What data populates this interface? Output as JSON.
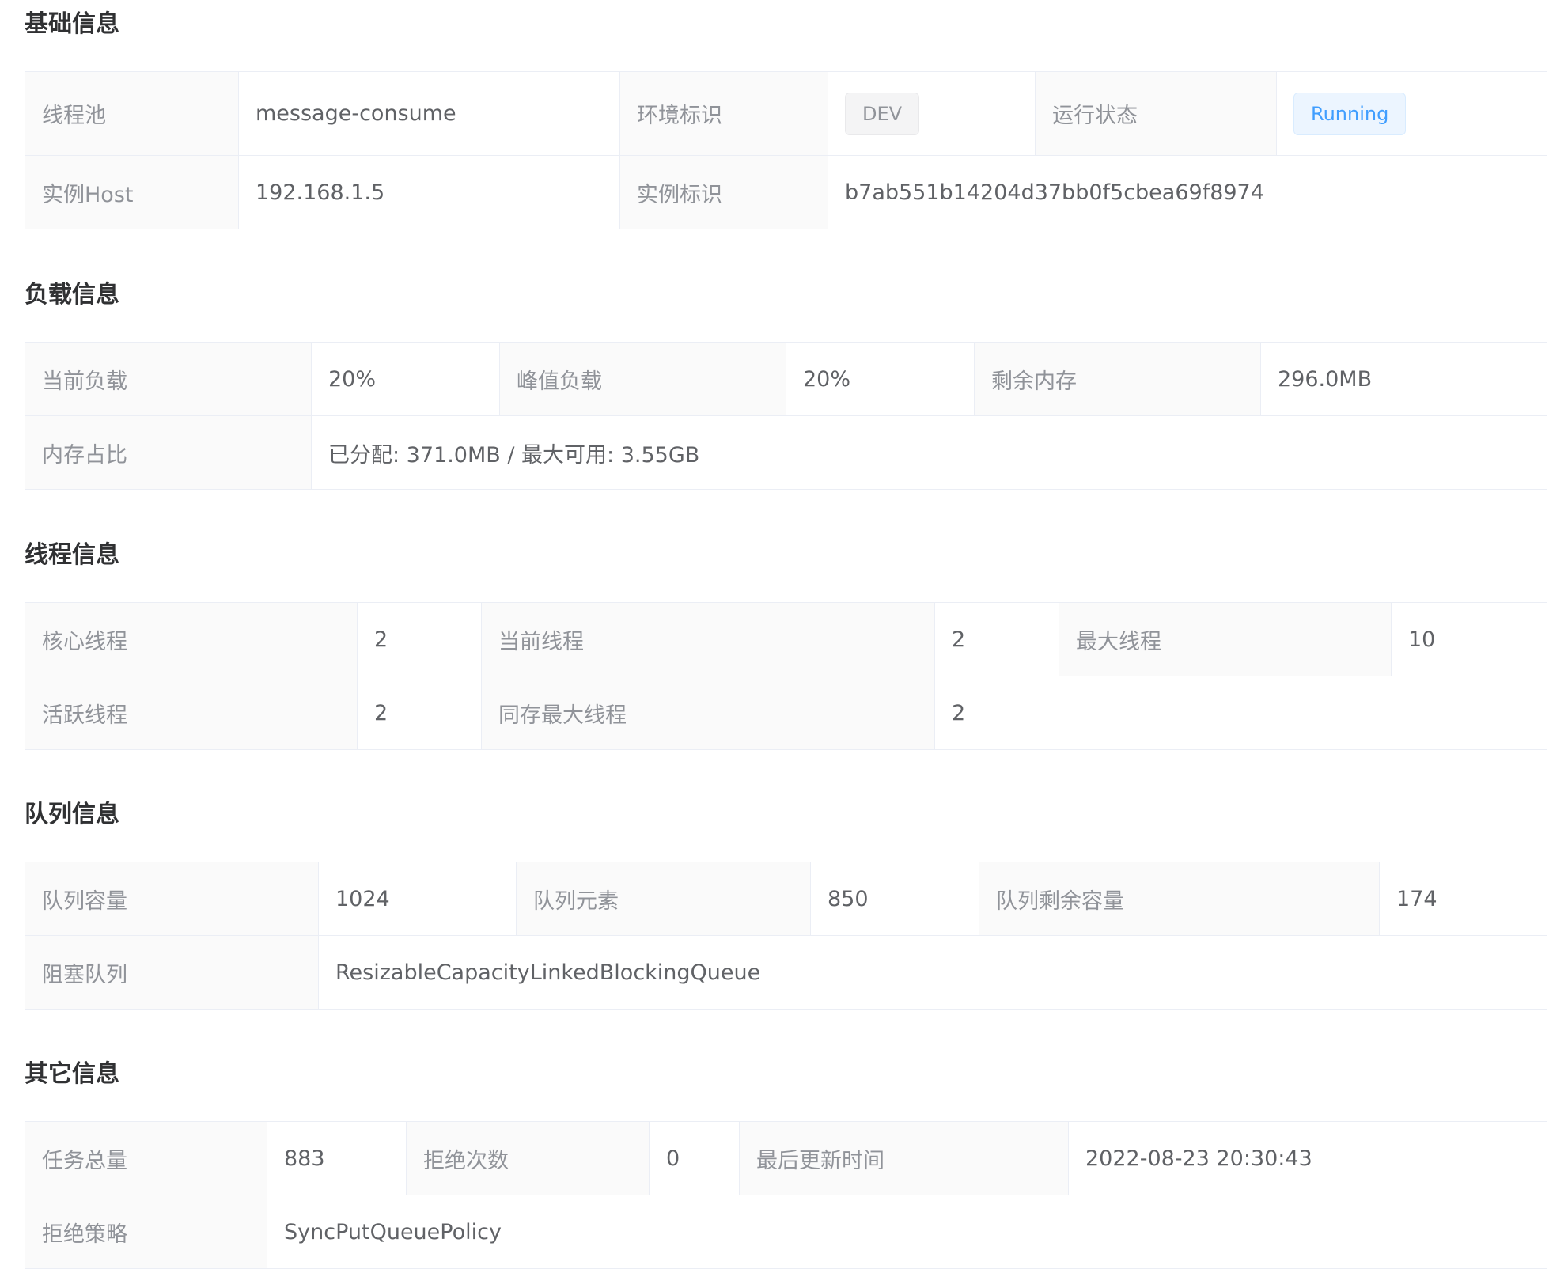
{
  "basic": {
    "title": "基础信息",
    "pool_label": "线程池",
    "pool_value": "message-consume",
    "env_label": "环境标识",
    "env_tag": "DEV",
    "status_label": "运行状态",
    "status_tag": "Running",
    "host_label": "实例Host",
    "host_value": "192.168.1.5",
    "instance_label": "实例标识",
    "instance_value": "b7ab551b14204d37bb0f5cbea69f8974"
  },
  "load": {
    "title": "负载信息",
    "current_label": "当前负载",
    "current_value": "20%",
    "peak_label": "峰值负载",
    "peak_value": "20%",
    "free_mem_label": "剩余内存",
    "free_mem_value": "296.0MB",
    "mem_ratio_label": "内存占比",
    "mem_ratio_value": "已分配: 371.0MB / 最大可用: 3.55GB"
  },
  "thread": {
    "title": "线程信息",
    "core_label": "核心线程",
    "core_value": "2",
    "current_label": "当前线程",
    "current_value": "2",
    "max_label": "最大线程",
    "max_value": "10",
    "active_label": "活跃线程",
    "active_value": "2",
    "largest_label": "同存最大线程",
    "largest_value": "2"
  },
  "queue": {
    "title": "队列信息",
    "capacity_label": "队列容量",
    "capacity_value": "1024",
    "elements_label": "队列元素",
    "elements_value": "850",
    "remaining_label": "队列剩余容量",
    "remaining_value": "174",
    "type_label": "阻塞队列",
    "type_value": "ResizableCapacityLinkedBlockingQueue"
  },
  "other": {
    "title": "其它信息",
    "task_total_label": "任务总量",
    "task_total_value": "883",
    "reject_count_label": "拒绝次数",
    "reject_count_value": "0",
    "last_update_label": "最后更新时间",
    "last_update_value": "2022-08-23 20:30:43",
    "reject_policy_label": "拒绝策略",
    "reject_policy_value": "SyncPutQueuePolicy"
  },
  "colors": {
    "label_bg": "#fafafa",
    "border": "#ebeef5",
    "label_text": "#909399",
    "value_text": "#606266",
    "primary": "#409eff"
  }
}
